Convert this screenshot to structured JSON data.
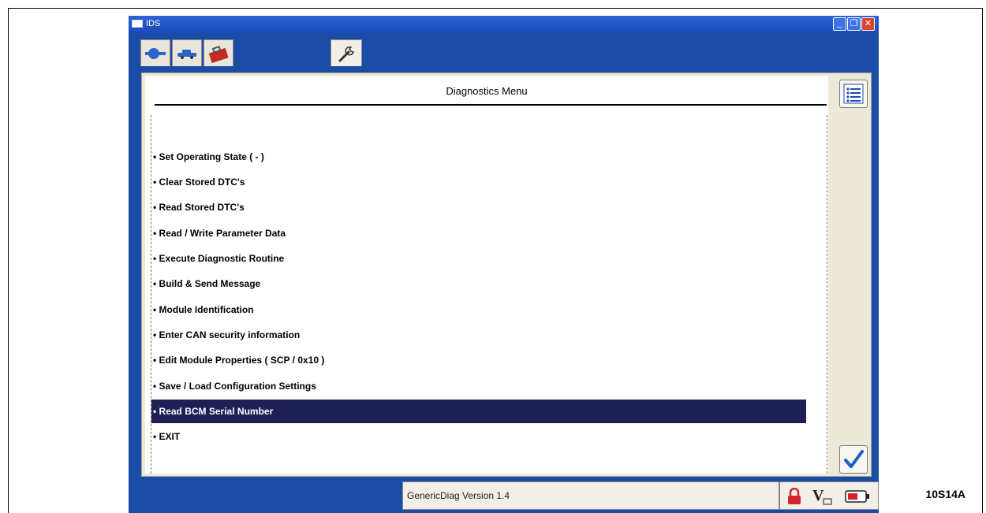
{
  "caption": "10S14A",
  "window": {
    "title": "IDS"
  },
  "menu": {
    "title": "Diagnostics Menu",
    "items": [
      "• Set Operating State ( - )",
      "• Clear Stored DTC's",
      "• Read Stored DTC's",
      "• Read / Write Parameter Data",
      "• Execute Diagnostic Routine",
      "• Build & Send Message",
      "• Module Identification",
      "• Enter CAN security information",
      "• Edit Module Properties ( SCP / 0x10 )",
      "• Save / Load Configuration Settings",
      "• Read BCM Serial Number",
      "• EXIT"
    ],
    "selected_index": 10
  },
  "status": {
    "version": "GenericDiag Version 1.4"
  },
  "icons": {
    "tabs": [
      "connector-icon",
      "vehicle-icon",
      "toolbox-icon",
      "wrench-icon"
    ],
    "side": [
      "list-icon",
      "checkmark-icon"
    ],
    "status": [
      "lock-icon",
      "voltage-icon",
      "battery-icon"
    ]
  },
  "colors": {
    "window_blue": "#1b4ca5",
    "selected_row": "#1e1f55",
    "lock_red": "#d0232f",
    "check_blue": "#1a5fc8"
  }
}
